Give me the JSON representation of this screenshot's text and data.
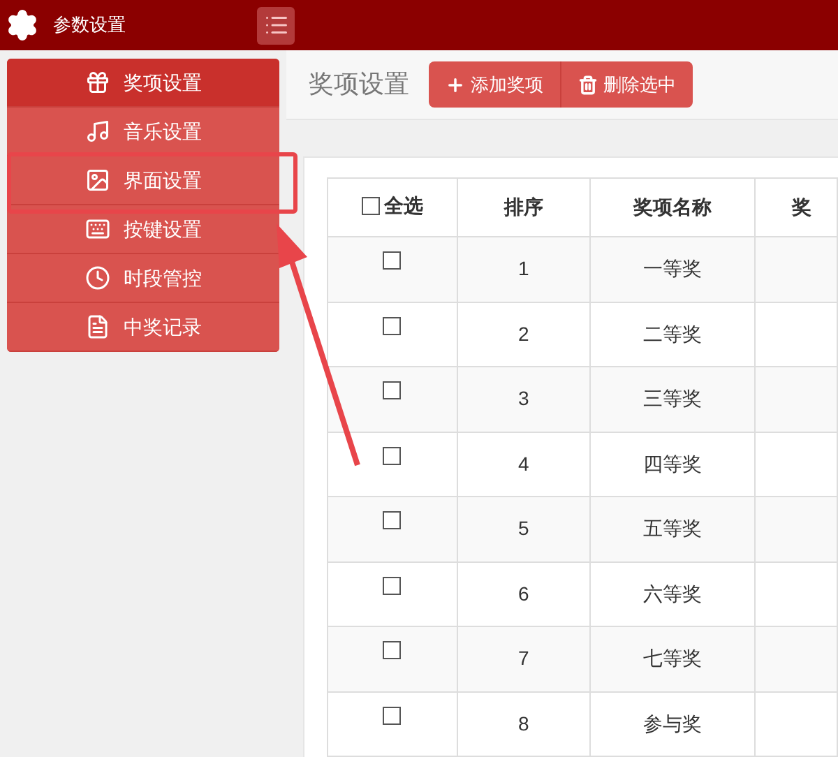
{
  "app_bar": {
    "title": "参数设置"
  },
  "sidebar": {
    "items": [
      {
        "label": "奖项设置",
        "selected": true
      },
      {
        "label": "音乐设置",
        "selected": false
      },
      {
        "label": "界面设置",
        "selected": false
      },
      {
        "label": "按键设置",
        "selected": false
      },
      {
        "label": "时段管控",
        "selected": false
      },
      {
        "label": "中奖记录",
        "selected": false
      }
    ]
  },
  "page_title": "奖项设置",
  "toolbar": {
    "buttons": [
      {
        "label": "添加奖项"
      },
      {
        "label": "删除选中"
      }
    ]
  },
  "table": {
    "select_all": {
      "label": "全选",
      "checked": false
    },
    "columns": [
      "排序",
      "奖项名称",
      "奖"
    ],
    "rows": [
      {
        "checked": false,
        "order": "1",
        "name": "一等奖"
      },
      {
        "checked": false,
        "order": "2",
        "name": "二等奖"
      },
      {
        "checked": false,
        "order": "3",
        "name": "三等奖"
      },
      {
        "checked": false,
        "order": "4",
        "name": "四等奖"
      },
      {
        "checked": false,
        "order": "5",
        "name": "五等奖"
      },
      {
        "checked": false,
        "order": "6",
        "name": "六等奖"
      },
      {
        "checked": false,
        "order": "7",
        "name": "七等奖"
      },
      {
        "checked": false,
        "order": "8",
        "name": "参与奖"
      }
    ]
  }
}
